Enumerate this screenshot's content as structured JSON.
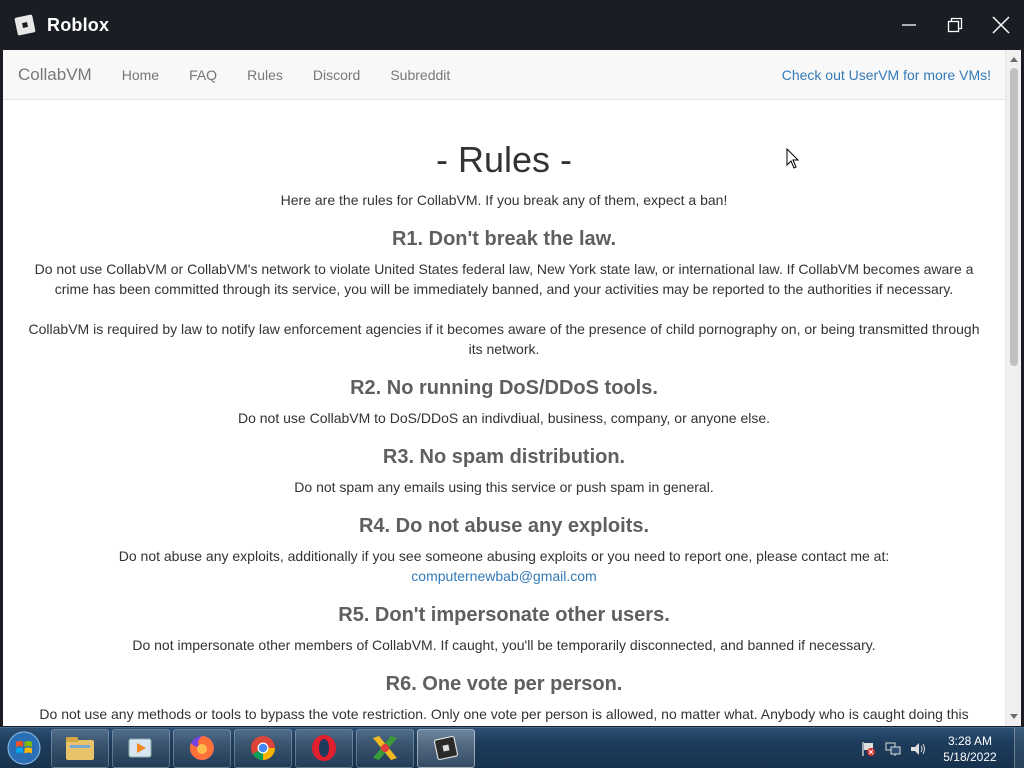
{
  "window": {
    "title": "Roblox"
  },
  "navbar": {
    "brand": "CollabVM",
    "links": [
      "Home",
      "FAQ",
      "Rules",
      "Discord",
      "Subreddit"
    ],
    "right_link": "Check out UserVM for more VMs!"
  },
  "page": {
    "title": "- Rules -",
    "intro": "Here are the rules for CollabVM. If you break any of them, expect a ban!",
    "rules": [
      {
        "heading": "R1. Don't break the law.",
        "paragraphs": [
          "Do not use CollabVM or CollabVM's network to violate United States federal law, New York state law, or international law. If CollabVM becomes aware a crime has been committed through its service, you will be immediately banned, and your activities may be reported to the authorities if necessary.",
          "CollabVM is required by law to notify law enforcement agencies if it becomes aware of the presence of child pornography on, or being transmitted through its network."
        ]
      },
      {
        "heading": "R2. No running DoS/DDoS tools.",
        "paragraphs": [
          "Do not use CollabVM to DoS/DDoS an indivdiual, business, company, or anyone else."
        ]
      },
      {
        "heading": "R3. No spam distribution.",
        "paragraphs": [
          "Do not spam any emails using this service or push spam in general."
        ]
      },
      {
        "heading": "R4. Do not abuse any exploits.",
        "paragraphs": [
          "Do not abuse any exploits, additionally if you see someone abusing exploits or you need to report one, please contact me at:"
        ],
        "email": "computernewbab@gmail.com"
      },
      {
        "heading": "R5. Don't impersonate other users.",
        "paragraphs": [
          "Do not impersonate other members of CollabVM. If caught, you'll be temporarily disconnected, and banned if necessary."
        ]
      },
      {
        "heading": "R6. One vote per person.",
        "paragraphs": [
          "Do not use any methods or tools to bypass the vote restriction. Only one vote per person is allowed, no matter what. Anybody who is caught doing this"
        ]
      }
    ]
  },
  "taskbar": {
    "apps": [
      "start-orb",
      "file-explorer",
      "media-player",
      "firefox",
      "chrome",
      "opera",
      "app-x",
      "roblox"
    ],
    "clock_time": "3:28 AM",
    "clock_date": "5/18/2022"
  }
}
